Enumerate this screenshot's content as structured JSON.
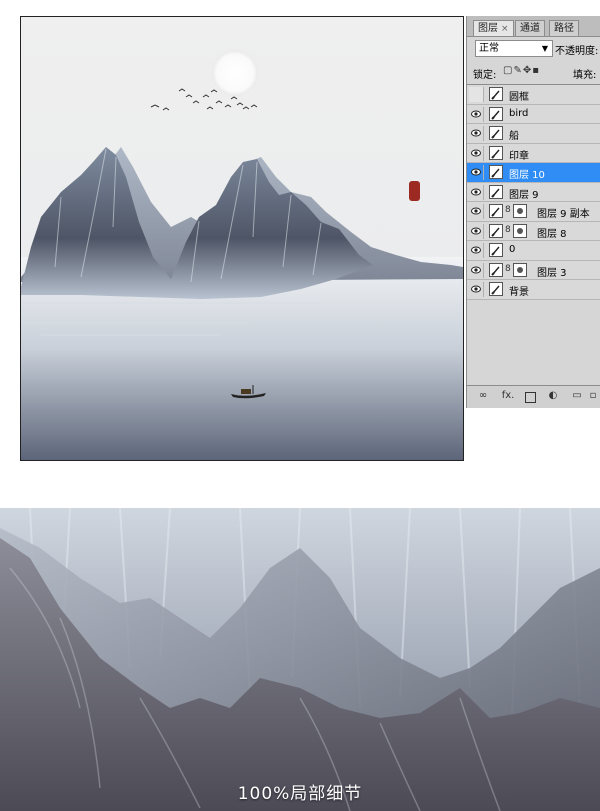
{
  "panel": {
    "tabs": [
      {
        "label": "图层",
        "close": "×"
      },
      {
        "label": "通道"
      },
      {
        "label": "路径"
      }
    ],
    "blend_mode": "正常",
    "opacity_label": "不透明度:",
    "lock_label": "锁定:",
    "fill_label": "填充:",
    "layers": [
      {
        "name": "圆框",
        "visible": false,
        "selected": false,
        "linked_mask": false
      },
      {
        "name": "bird",
        "visible": true,
        "selected": false,
        "linked_mask": false
      },
      {
        "name": "船",
        "visible": true,
        "selected": false,
        "linked_mask": false
      },
      {
        "name": "印章",
        "visible": true,
        "selected": false,
        "linked_mask": false
      },
      {
        "name": "图层 10",
        "visible": true,
        "selected": true,
        "linked_mask": false
      },
      {
        "name": "图层 9",
        "visible": true,
        "selected": false,
        "linked_mask": false
      },
      {
        "name": "图层 9 副本",
        "visible": true,
        "selected": false,
        "linked_mask": true
      },
      {
        "name": "图层 8",
        "visible": true,
        "selected": false,
        "linked_mask": true
      },
      {
        "name": "0",
        "visible": true,
        "selected": false,
        "linked_mask": false
      },
      {
        "name": "图层 3",
        "visible": true,
        "selected": false,
        "linked_mask": true
      },
      {
        "name": "背景",
        "visible": true,
        "selected": false,
        "linked_mask": false
      }
    ],
    "bottom_icons": [
      "link-icon",
      "fx-icon",
      "add-mask-icon",
      "adjustment-icon",
      "folder-icon",
      "new-layer-icon",
      "trash-icon"
    ],
    "fx_label": "fx.",
    "selected_color": "#2f8df5"
  },
  "detail": {
    "caption": "100%局部细节"
  }
}
